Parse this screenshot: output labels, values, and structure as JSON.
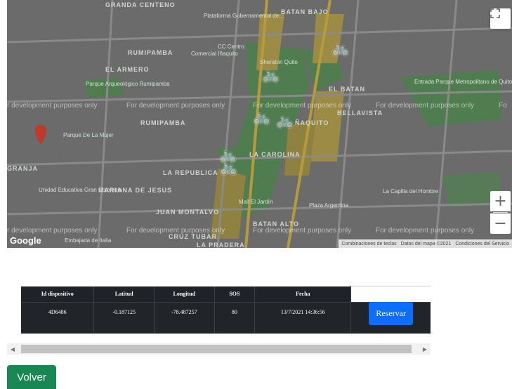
{
  "map": {
    "watermarks": [
      "r development purposes only",
      "For development purposes only",
      "For development purposes only",
      "For development purposes only",
      "For development purposes only",
      "r development purposes only",
      "For development purposes only",
      "For development purposes only",
      "For development purposes only",
      "For development purposes only"
    ],
    "places": {
      "granda_centeno": "GRANDA CENTENO",
      "batan_bajo": "BATAN BAJO",
      "plataforma": "Plataforma Gubernamental de...",
      "rumipamba": "RUMIPAMBA",
      "comercial": "Comercial Iñaquito",
      "cc_centro": "CC Centro",
      "el_armero": "EL ARMERO",
      "sheraton": "Sheraton Quito",
      "parque_arqueologico": "Parque Arqueológico Rumipamba",
      "el_batan": "EL BATAN",
      "entrada_parque": "Entrada Parque Metropolitano de Quito",
      "bellavista": "BELLAVISTA",
      "rumipamba2": "RUMIPAMBA",
      "naquito": "ÑAQUITO",
      "parque_de_la_mujer": "Parque De La Mujer",
      "granja": "GRANJA",
      "la_carolina": "LA CAROLINA",
      "la_republica": "LA REPUBLICA",
      "unidad_educativa": "Unidad Educativa Gran Colombia",
      "mariana_de_jesus": "MARIANA DE JESUS",
      "capilla": "La Capilla del Hombre",
      "mall_la_carolina": "Mall El Jardín",
      "juan_montalvo": "JUAN MONTALVO",
      "plaza_argentina": "Plaza Argentina",
      "batan_alto": "BATAN ALTO",
      "cruz_tubar": "CRUZ TUBAR",
      "la_pradera": "LA PRADERA",
      "embajada": "Embajada de Italia"
    },
    "google_logo": "Google",
    "attribution": [
      "Combinaciones de teclas",
      "Datos del mapa ©2021",
      "Condiciones del Servicio"
    ],
    "zoom_in": "+",
    "zoom_out": "−"
  },
  "table": {
    "headers": [
      "Id dispositivo",
      "Latitud",
      "Longitud",
      "SOS",
      "Fecha"
    ],
    "rows": [
      {
        "id": "4D6486",
        "lat": "-0.187125",
        "lng": "-78.487257",
        "sos": "80",
        "fecha": "13/7/2021 14:36:56",
        "action": "Reservar"
      }
    ]
  },
  "back_button": "Volver",
  "colors": {
    "primary": "#0d6efd",
    "success": "#198754",
    "table_dark": "#212529"
  }
}
